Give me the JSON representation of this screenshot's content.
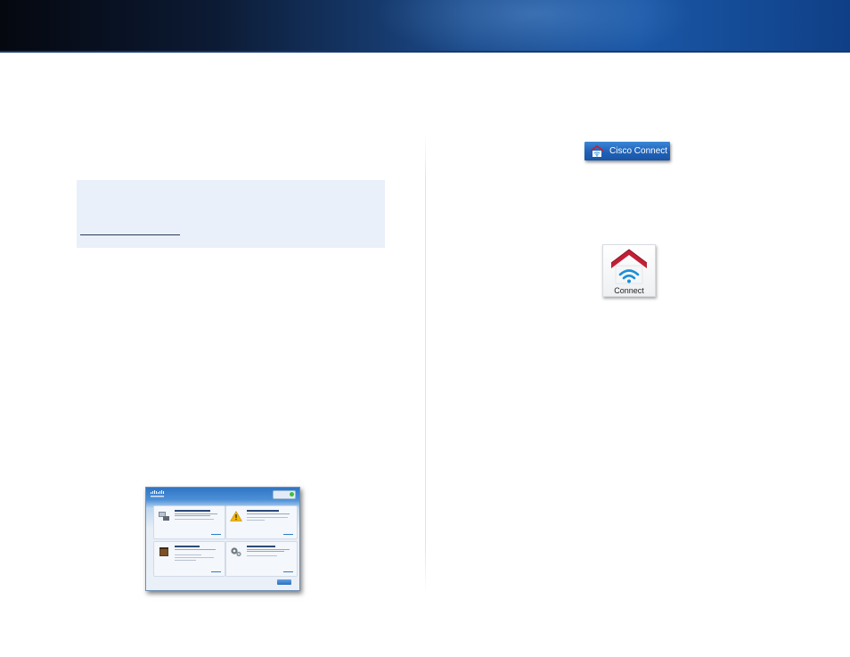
{
  "taskbar_button": {
    "label": "Cisco Connect",
    "accent": "#1f62b8"
  },
  "app_icon": {
    "label": "Connect",
    "roof_color": "#c21f35",
    "wifi_color": "#1d8fd6"
  },
  "window_screenshot": {
    "brand": "cisco",
    "panels": [
      {
        "icon": "computers-devices-icon"
      },
      {
        "icon": "parental-controls-warning-icon"
      },
      {
        "icon": "guest-access-icon"
      },
      {
        "icon": "router-settings-gear-icon"
      }
    ]
  },
  "colors": {
    "banner_dark": "#05080f",
    "banner_blue": "#1a57a6",
    "note_background": "#e9f0fa"
  }
}
